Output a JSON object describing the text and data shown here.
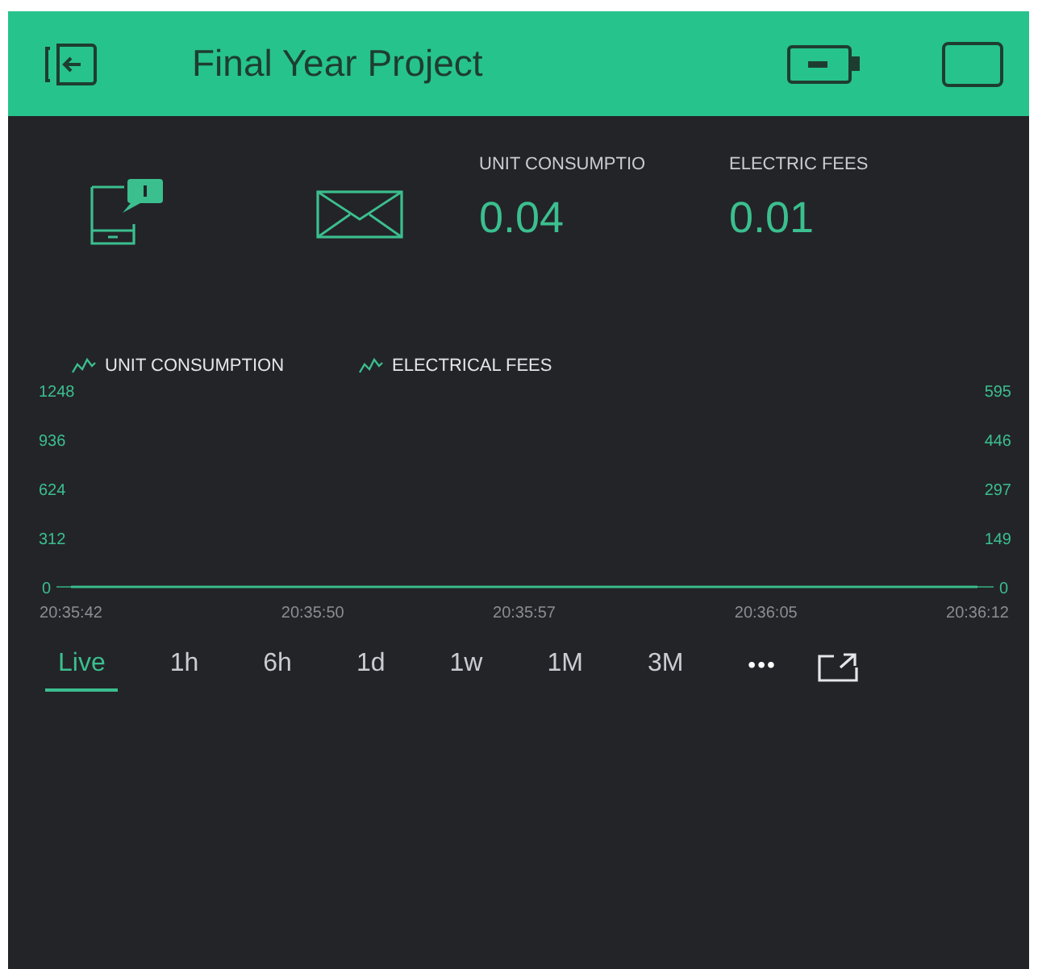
{
  "header": {
    "title": "Final Year Project"
  },
  "widgets": [
    {
      "kind": "notification"
    },
    {
      "kind": "email"
    },
    {
      "kind": "value",
      "label": "UNIT CONSUMPTIO",
      "value": "0.04"
    },
    {
      "kind": "value",
      "label": "ELECTRIC FEES",
      "value": "0.01"
    }
  ],
  "chart": {
    "chart_data": {
      "type": "line",
      "x": [
        "20:35:42",
        "20:35:50",
        "20:35:57",
        "20:36:05",
        "20:36:12"
      ],
      "ylim": [
        0,
        1248
      ],
      "yticks": [
        0,
        312,
        624,
        936,
        1248
      ],
      "y2lim": [
        0,
        595
      ],
      "y2ticks": [
        0,
        149,
        297,
        446,
        595
      ],
      "legend": true,
      "series": [
        {
          "name": "UNIT CONSUMPTION",
          "color": "#3bbf8f",
          "values": [
            0,
            0,
            0,
            0,
            0
          ]
        },
        {
          "name": "ELECTRICAL FEES",
          "color": "#3bbf8f",
          "values": [
            0,
            0,
            0,
            0,
            0
          ]
        }
      ]
    }
  },
  "ranges": [
    {
      "label": "Live",
      "selected": true
    },
    {
      "label": "1h",
      "selected": false
    },
    {
      "label": "6h",
      "selected": false
    },
    {
      "label": "1d",
      "selected": false
    },
    {
      "label": "1w",
      "selected": false
    },
    {
      "label": "1M",
      "selected": false
    },
    {
      "label": "3M",
      "selected": false
    }
  ],
  "more": "•••"
}
